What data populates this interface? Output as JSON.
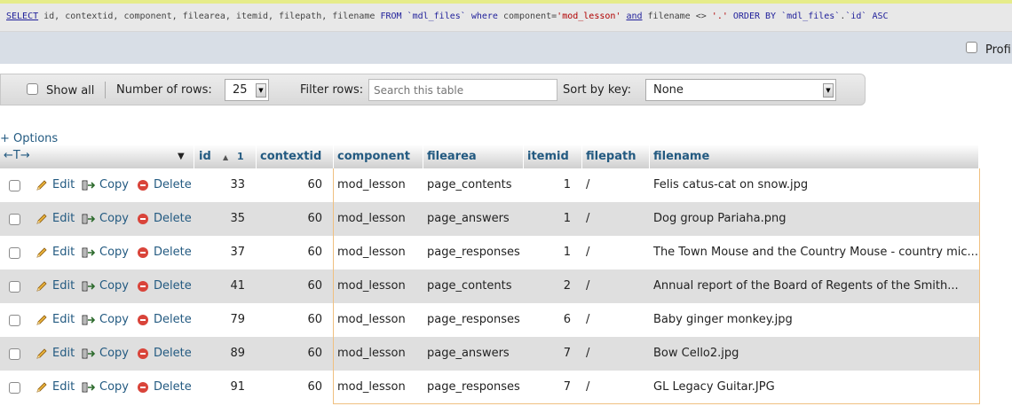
{
  "sql": {
    "p1": "SELECT",
    "p2": " id, contextid, component, filearea, itemid, filepath, filename ",
    "p3": "FROM",
    "p4": " ",
    "p5": "`mdl_files`",
    "p6": " ",
    "p7": "where",
    "p8": " component=",
    "p9": "'mod_lesson'",
    "p10": " ",
    "p11": "and",
    "p12": " filename <> ",
    "p13": "'.'",
    "p14": " ",
    "p15": "ORDER BY",
    "p16": " ",
    "p17": "`mdl_files`",
    "p18": ".",
    "p19": "`id`",
    "p20": " ",
    "p21": "ASC"
  },
  "profiling": {
    "label": "Profiling"
  },
  "nav": {
    "show_all": "Show all",
    "rows_label": "Number of rows:",
    "rows_value": "25",
    "filter_label": "Filter rows:",
    "filter_placeholder": "Search this table",
    "sort_label": "Sort by key:",
    "sort_value": "None"
  },
  "options_label": "+ Options",
  "table": {
    "arrows": "←T→",
    "sort_indicator": "▲",
    "sort_order": "1",
    "headers": {
      "id": "id",
      "contextid": "contextid",
      "component": "component",
      "filearea": "filearea",
      "itemid": "itemid",
      "filepath": "filepath",
      "filename": "filename"
    },
    "actions": {
      "edit": "Edit",
      "copy": "Copy",
      "delete": "Delete"
    },
    "rows": [
      {
        "id": "33",
        "contextid": "60",
        "component": "mod_lesson",
        "filearea": "page_contents",
        "itemid": "1",
        "filepath": "/",
        "filename": "Felis catus-cat on snow.jpg"
      },
      {
        "id": "35",
        "contextid": "60",
        "component": "mod_lesson",
        "filearea": "page_answers",
        "itemid": "1",
        "filepath": "/",
        "filename": "Dog group Pariaha.png"
      },
      {
        "id": "37",
        "contextid": "60",
        "component": "mod_lesson",
        "filearea": "page_responses",
        "itemid": "1",
        "filepath": "/",
        "filename": "The Town Mouse and the Country Mouse - country mic..."
      },
      {
        "id": "41",
        "contextid": "60",
        "component": "mod_lesson",
        "filearea": "page_contents",
        "itemid": "2",
        "filepath": "/",
        "filename": "Annual report of the Board of Regents of the Smith..."
      },
      {
        "id": "79",
        "contextid": "60",
        "component": "mod_lesson",
        "filearea": "page_responses",
        "itemid": "6",
        "filepath": "/",
        "filename": "Baby ginger monkey.jpg"
      },
      {
        "id": "89",
        "contextid": "60",
        "component": "mod_lesson",
        "filearea": "page_answers",
        "itemid": "7",
        "filepath": "/",
        "filename": "Bow Cello2.jpg"
      },
      {
        "id": "91",
        "contextid": "60",
        "component": "mod_lesson",
        "filearea": "page_responses",
        "itemid": "7",
        "filepath": "/",
        "filename": "GL Legacy Guitar.JPG"
      }
    ]
  },
  "colors": {
    "link": "#235a81",
    "delete_icon": "#d9443a",
    "highlight_border": "#f0c080",
    "row_alt": "#dfdfdf"
  }
}
